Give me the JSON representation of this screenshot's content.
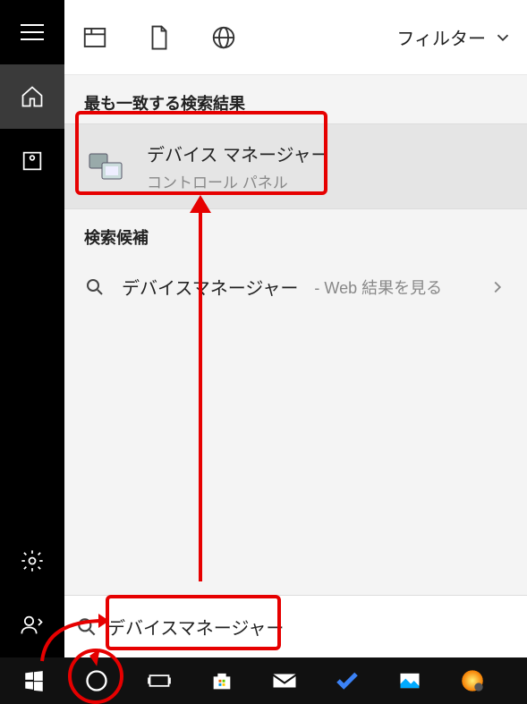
{
  "sidebar": {
    "menu_icon": "hamburger-icon",
    "home_icon": "home-icon",
    "card_icon": "saved-icon",
    "settings_icon": "gear-icon",
    "feedback_icon": "feedback-icon"
  },
  "toolbar": {
    "apps_icon": "apps-icon",
    "documents_icon": "document-icon",
    "web_icon": "globe-icon",
    "filter_label": "フィルター",
    "chevron": "chevron-down-icon"
  },
  "results": {
    "best_match_header": "最も一致する検索結果",
    "best_match": {
      "icon": "device-manager-icon",
      "title": "デバイス マネージャー",
      "subtitle": "コントロール パネル"
    },
    "suggestions_header": "検索候補",
    "suggestions": [
      {
        "icon": "search-icon",
        "label": "デバイスマネージャー",
        "suffix": " - Web 結果を見る",
        "chevron": "chevron-right-icon"
      }
    ]
  },
  "search": {
    "icon": "search-icon",
    "value": "デバイスマネージャー",
    "placeholder": ""
  },
  "taskbar": {
    "items": [
      {
        "name": "start-button",
        "icon": "windows-icon"
      },
      {
        "name": "cortana-button",
        "icon": "cortana-circle-icon"
      },
      {
        "name": "taskview-button",
        "icon": "taskview-icon"
      },
      {
        "name": "store-button",
        "icon": "store-icon"
      },
      {
        "name": "mail-button",
        "icon": "mail-icon"
      },
      {
        "name": "todo-button",
        "icon": "check-icon"
      },
      {
        "name": "photos-button",
        "icon": "photos-icon"
      },
      {
        "name": "app-button",
        "icon": "orb-icon"
      }
    ]
  },
  "annotations": {
    "highlight_color": "#e60000"
  }
}
